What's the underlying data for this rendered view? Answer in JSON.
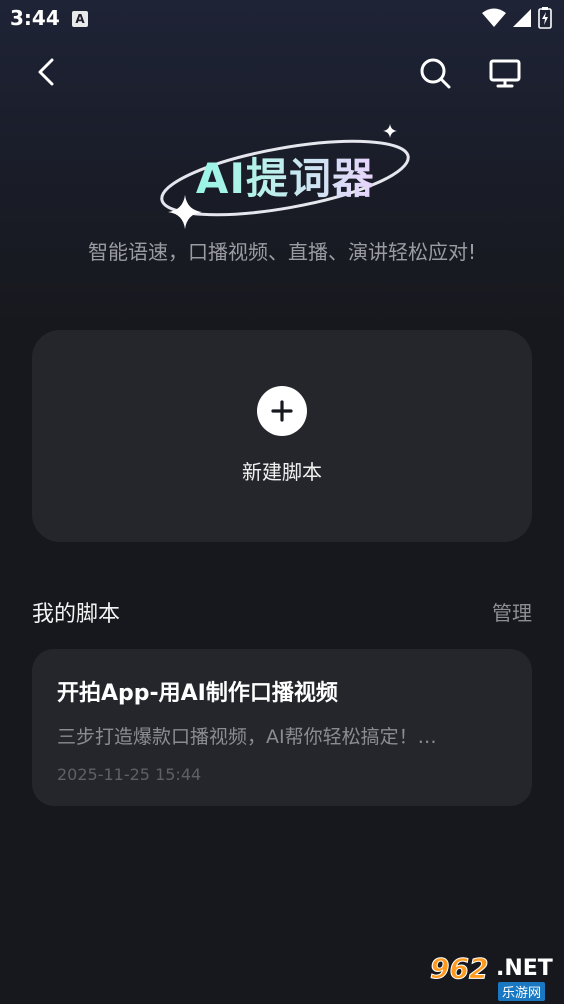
{
  "status_bar": {
    "time": "3:44",
    "notification_icon": "A"
  },
  "topbar": {
    "back_icon": "chevron-left-icon",
    "search_icon": "search-icon",
    "screen_icon": "monitor-icon"
  },
  "hero": {
    "title": "AI提词器",
    "subtitle": "智能语速，口播视频、直播、演讲轻松应对!"
  },
  "new_script": {
    "label": "新建脚本"
  },
  "section": {
    "title": "我的脚本",
    "manage": "管理"
  },
  "scripts": [
    {
      "title": "开拍App-用AI制作口播视频",
      "desc": "三步打造爆款口播视频，AI帮你轻松搞定！…",
      "date": "2025-11-25 15:44"
    }
  ],
  "watermark": {
    "number": "962",
    "domain": ".NET",
    "cn": "乐游网"
  },
  "colors": {
    "background": "#17181d",
    "card": "#25262b",
    "accent_cyan": "#8ff6e5",
    "accent_pink": "#f0cfff"
  }
}
